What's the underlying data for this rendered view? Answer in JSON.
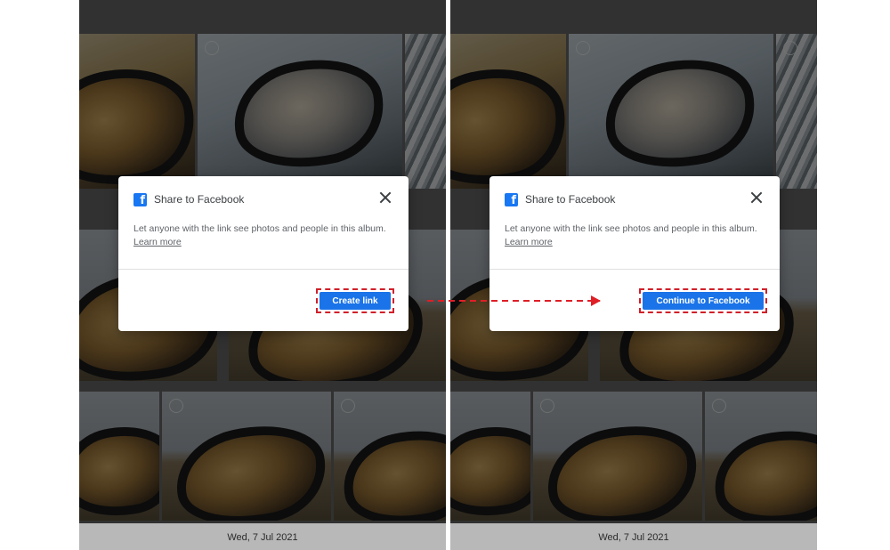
{
  "left": {
    "dialog": {
      "title": "Share to Facebook",
      "message": "Let anyone with the link see photos and people in this album.",
      "learn_more": "Learn more",
      "button_label": "Create link"
    },
    "date": "Wed, 7 Jul 2021"
  },
  "right": {
    "dialog": {
      "title": "Share to Facebook",
      "message": "Let anyone with the link see photos and people in this album.",
      "learn_more": "Learn more",
      "button_label": "Continue to Facebook"
    },
    "date": "Wed, 7 Jul 2021"
  },
  "icons": {
    "facebook": "facebook-icon",
    "close": "close-icon",
    "arrow": "arrow-right-icon"
  },
  "colors": {
    "primary_button": "#1a73e8",
    "highlight_dash": "#d0202a",
    "facebook_blue": "#1877f2"
  }
}
